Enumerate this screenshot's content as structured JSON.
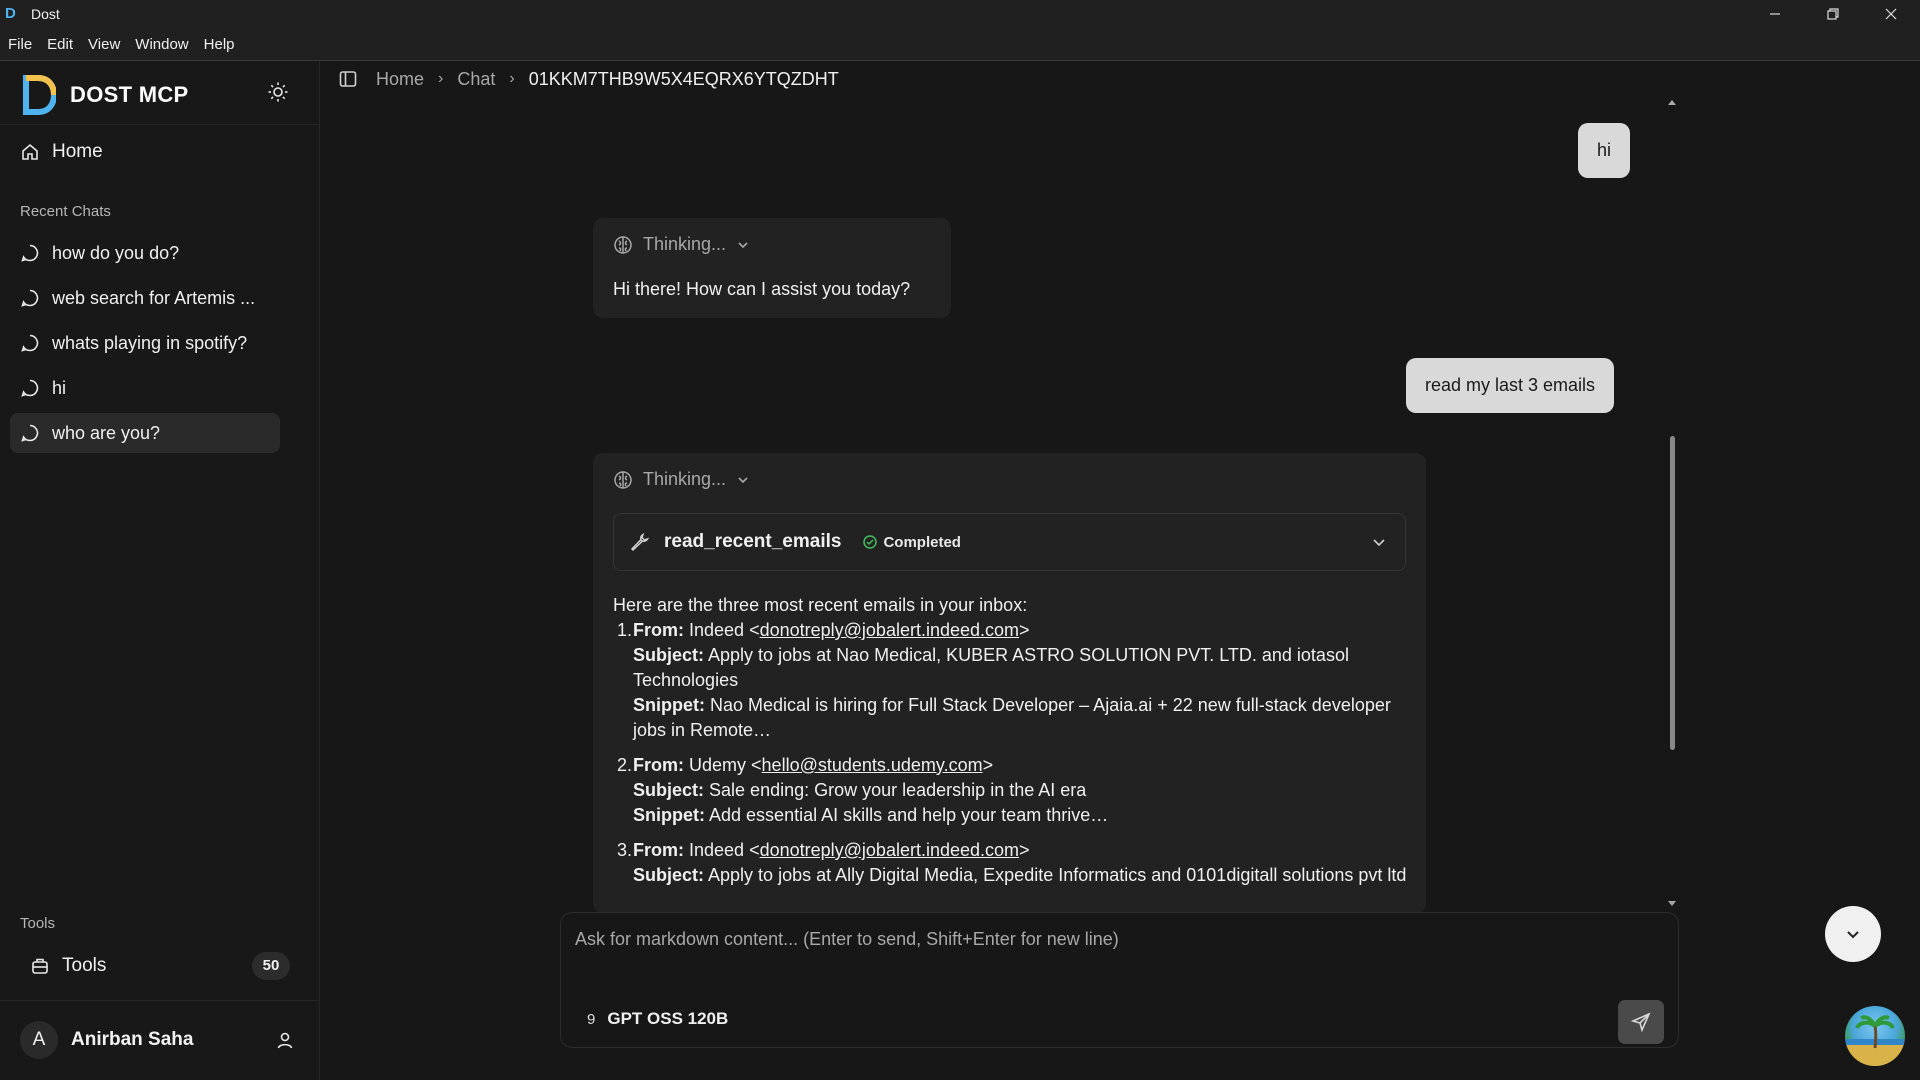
{
  "window": {
    "title": "Dost",
    "app_icon_letter": "D"
  },
  "menu": [
    "File",
    "Edit",
    "View",
    "Window",
    "Help"
  ],
  "sidebar": {
    "brand": "DOST MCP",
    "home_label": "Home",
    "recent_label": "Recent Chats",
    "recent_chats": [
      {
        "label": "how do you do?"
      },
      {
        "label": "web search for Artemis ..."
      },
      {
        "label": "whats playing in spotify?"
      },
      {
        "label": "hi"
      },
      {
        "label": "who are you?",
        "active": true
      }
    ],
    "tools_section_label": "Tools",
    "tools_label": "Tools",
    "tools_count": "50",
    "user": {
      "initial": "A",
      "name": "Anirban Saha"
    }
  },
  "breadcrumb": {
    "home": "Home",
    "chat": "Chat",
    "current": "01KKM7THB9W5X4EQRX6YTQZDHT"
  },
  "messages": {
    "user_1": "hi",
    "thinking_label": "Thinking...",
    "ai_1": "Hi there! How can I assist you today?",
    "user_2": "read my last 3 emails",
    "tool": {
      "name": "read_recent_emails",
      "status": "Completed"
    },
    "ai_2_intro": "Here are the three most recent emails in your inbox:",
    "emails": [
      {
        "num": "1.",
        "from_label": "From:",
        "from_name": "Indeed <",
        "from_email": "donotreply@jobalert.indeed.com",
        "from_end": ">",
        "subject_label": "Subject:",
        "subject": "Apply to jobs at Nao Medical, KUBER ASTRO SOLUTION PVT. LTD. and iotasol Technologies",
        "snippet_label": "Snippet:",
        "snippet": "Nao Medical is hiring for Full Stack Developer – Ajaia.ai + 22 new full-stack developer jobs in Remote…"
      },
      {
        "num": "2.",
        "from_label": "From:",
        "from_name": "Udemy <",
        "from_email": "hello@students.udemy.com",
        "from_end": ">",
        "subject_label": "Subject:",
        "subject": "Sale ending: Grow your leadership in the AI era",
        "snippet_label": "Snippet:",
        "snippet": "Add essential AI skills and help your team thrive…"
      },
      {
        "num": "3.",
        "from_label": "From:",
        "from_name": "Indeed <",
        "from_email": "donotreply@jobalert.indeed.com",
        "from_end": ">",
        "subject_label": "Subject:",
        "subject": "Apply to jobs at Ally Digital Media, Expedite Informatics and 0101digitall solutions pvt ltd"
      }
    ]
  },
  "composer": {
    "placeholder": "Ask for markdown content... (Enter to send, Shift+Enter for new line)",
    "model_icon": "9",
    "model": "GPT OSS 120B"
  },
  "colors": {
    "background": "#171717",
    "sidebar": "#181818",
    "card": "#222222",
    "user_bubble": "#d9d9d9",
    "brand_blue": "#4fb3f0",
    "success": "#3fbf5f"
  }
}
